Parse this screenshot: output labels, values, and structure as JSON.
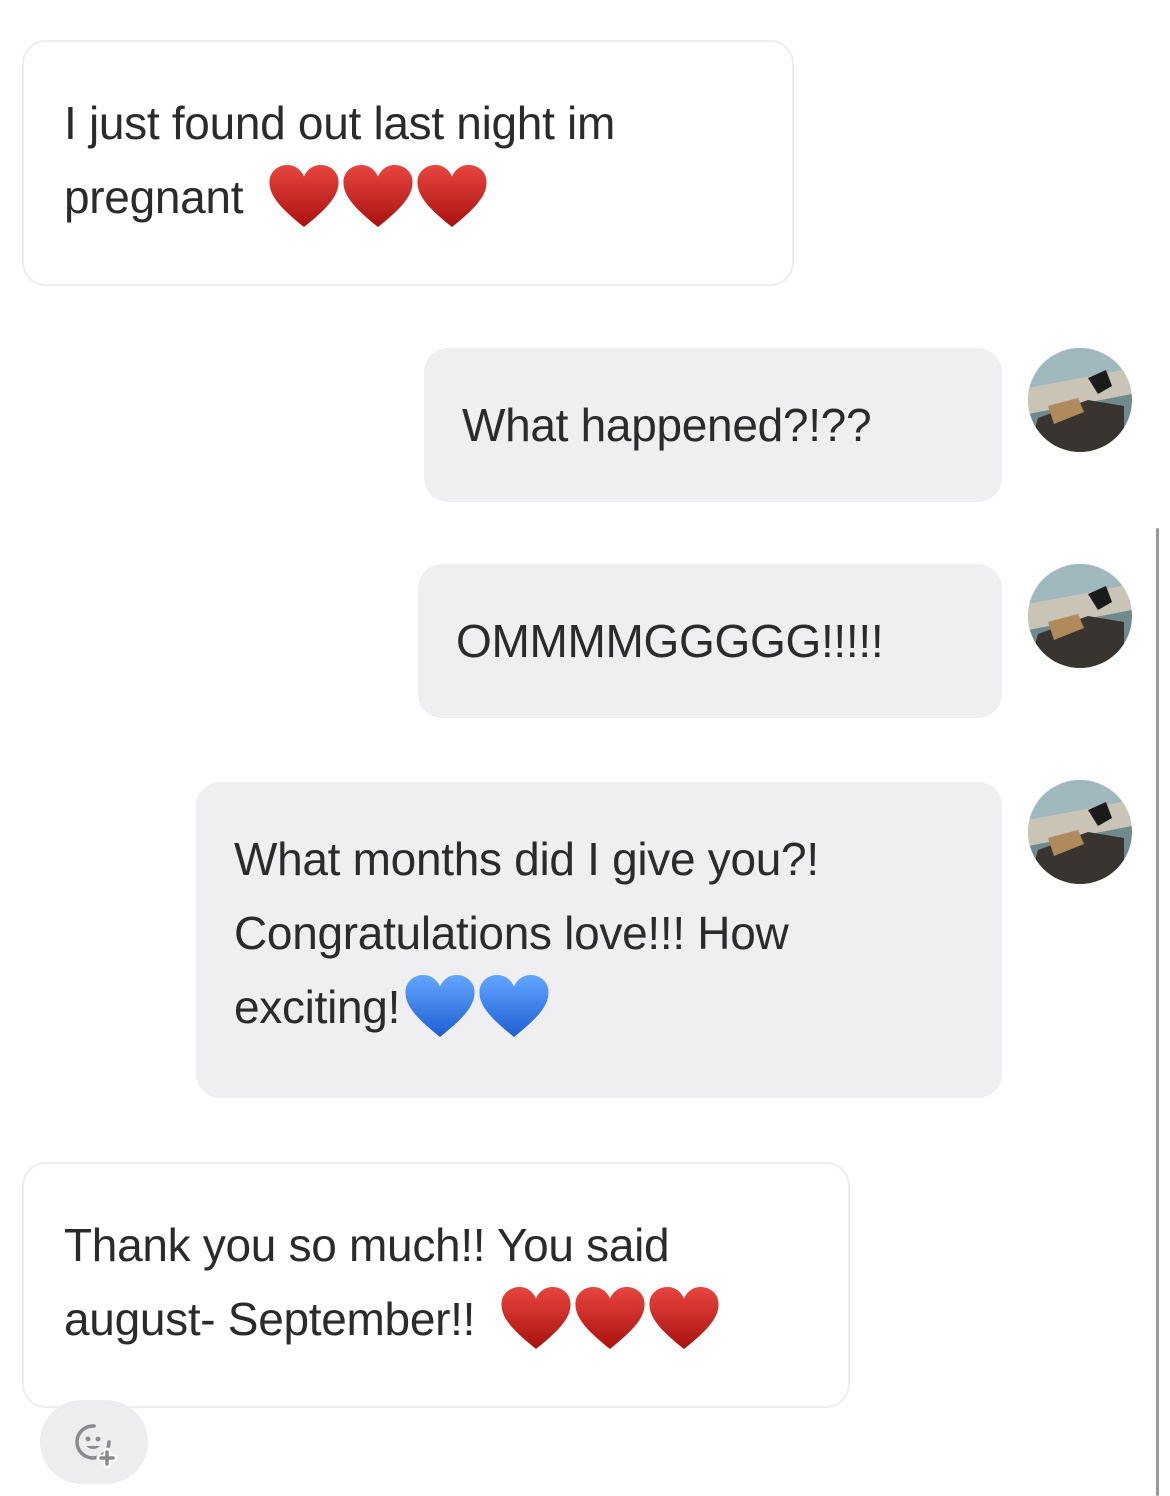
{
  "messages": [
    {
      "direction": "incoming",
      "lines": [
        "I just found out last night im",
        "pregnant"
      ],
      "trailing_emoji": "red-heart-icon",
      "emoji_count": 3
    },
    {
      "direction": "outgoing",
      "lines": [
        "What happened?!??"
      ]
    },
    {
      "direction": "outgoing",
      "lines": [
        "OMMMMGGGGG!!!!!"
      ]
    },
    {
      "direction": "outgoing",
      "lines": [
        "What months did I give you?!",
        "Congratulations love!!! How",
        "exciting!"
      ],
      "trailing_emoji": "blue-heart-icon",
      "emoji_count": 2
    },
    {
      "direction": "incoming",
      "lines": [
        "Thank you so much!! You said",
        "august- September!!"
      ],
      "trailing_emoji": "red-heart-icon",
      "emoji_count": 3
    }
  ],
  "controls": {
    "reaction_button_icon": "add-reaction-icon"
  },
  "colors": {
    "incoming_bubble": "#ffffff",
    "incoming_border": "#eeeeee",
    "outgoing_bubble": "#efeff2",
    "text": "#2b2b2b",
    "red_heart": "#c8211f",
    "blue_heart": "#2f7ee8",
    "scrollbar": "#9a9a9a"
  }
}
